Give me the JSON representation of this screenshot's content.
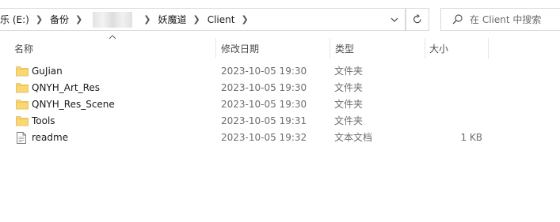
{
  "breadcrumb": {
    "items": [
      "乐 (E:)",
      "备份",
      "",
      "妖魔道",
      "Client"
    ]
  },
  "search": {
    "placeholder": "在 Client 中搜索"
  },
  "columns": {
    "name": "名称",
    "date": "修改日期",
    "type": "类型",
    "size": "大小"
  },
  "files": [
    {
      "name": "GuJian",
      "date": "2023-10-05 19:30",
      "type": "文件夹",
      "size": "",
      "icon": "folder-icon"
    },
    {
      "name": "QNYH_Art_Res",
      "date": "2023-10-05 19:30",
      "type": "文件夹",
      "size": "",
      "icon": "folder-icon"
    },
    {
      "name": "QNYH_Res_Scene",
      "date": "2023-10-05 19:30",
      "type": "文件夹",
      "size": "",
      "icon": "folder-icon"
    },
    {
      "name": "Tools",
      "date": "2023-10-05 19:31",
      "type": "文件夹",
      "size": "",
      "icon": "folder-icon"
    },
    {
      "name": "readme",
      "date": "2023-10-05 19:32",
      "type": "文本文档",
      "size": "1 KB",
      "icon": "text-file-icon"
    }
  ],
  "colors": {
    "folder": "#f8d775",
    "folder_dark": "#e8b84a",
    "border": "#d9d9d9"
  }
}
